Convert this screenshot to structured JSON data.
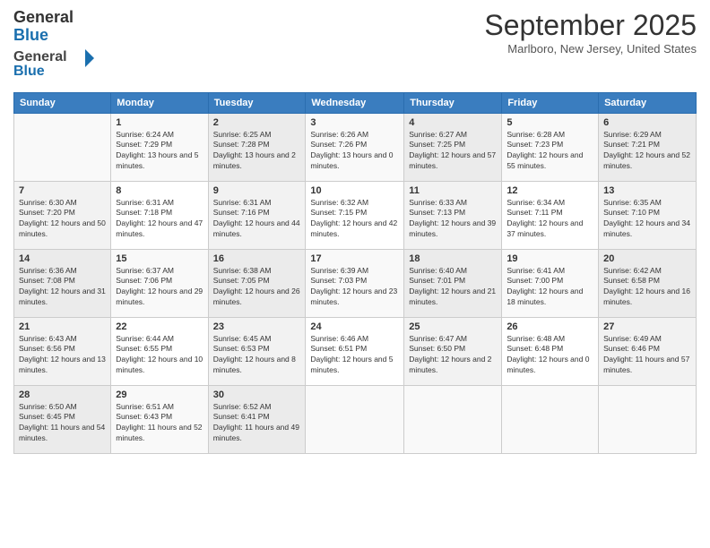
{
  "header": {
    "logo_general": "General",
    "logo_blue": "Blue",
    "month_title": "September 2025",
    "location": "Marlboro, New Jersey, United States"
  },
  "days_of_week": [
    "Sunday",
    "Monday",
    "Tuesday",
    "Wednesday",
    "Thursday",
    "Friday",
    "Saturday"
  ],
  "weeks": [
    [
      {
        "day": "",
        "sunrise": "",
        "sunset": "",
        "daylight": ""
      },
      {
        "day": "1",
        "sunrise": "Sunrise: 6:24 AM",
        "sunset": "Sunset: 7:29 PM",
        "daylight": "Daylight: 13 hours and 5 minutes."
      },
      {
        "day": "2",
        "sunrise": "Sunrise: 6:25 AM",
        "sunset": "Sunset: 7:28 PM",
        "daylight": "Daylight: 13 hours and 2 minutes."
      },
      {
        "day": "3",
        "sunrise": "Sunrise: 6:26 AM",
        "sunset": "Sunset: 7:26 PM",
        "daylight": "Daylight: 13 hours and 0 minutes."
      },
      {
        "day": "4",
        "sunrise": "Sunrise: 6:27 AM",
        "sunset": "Sunset: 7:25 PM",
        "daylight": "Daylight: 12 hours and 57 minutes."
      },
      {
        "day": "5",
        "sunrise": "Sunrise: 6:28 AM",
        "sunset": "Sunset: 7:23 PM",
        "daylight": "Daylight: 12 hours and 55 minutes."
      },
      {
        "day": "6",
        "sunrise": "Sunrise: 6:29 AM",
        "sunset": "Sunset: 7:21 PM",
        "daylight": "Daylight: 12 hours and 52 minutes."
      }
    ],
    [
      {
        "day": "7",
        "sunrise": "Sunrise: 6:30 AM",
        "sunset": "Sunset: 7:20 PM",
        "daylight": "Daylight: 12 hours and 50 minutes."
      },
      {
        "day": "8",
        "sunrise": "Sunrise: 6:31 AM",
        "sunset": "Sunset: 7:18 PM",
        "daylight": "Daylight: 12 hours and 47 minutes."
      },
      {
        "day": "9",
        "sunrise": "Sunrise: 6:31 AM",
        "sunset": "Sunset: 7:16 PM",
        "daylight": "Daylight: 12 hours and 44 minutes."
      },
      {
        "day": "10",
        "sunrise": "Sunrise: 6:32 AM",
        "sunset": "Sunset: 7:15 PM",
        "daylight": "Daylight: 12 hours and 42 minutes."
      },
      {
        "day": "11",
        "sunrise": "Sunrise: 6:33 AM",
        "sunset": "Sunset: 7:13 PM",
        "daylight": "Daylight: 12 hours and 39 minutes."
      },
      {
        "day": "12",
        "sunrise": "Sunrise: 6:34 AM",
        "sunset": "Sunset: 7:11 PM",
        "daylight": "Daylight: 12 hours and 37 minutes."
      },
      {
        "day": "13",
        "sunrise": "Sunrise: 6:35 AM",
        "sunset": "Sunset: 7:10 PM",
        "daylight": "Daylight: 12 hours and 34 minutes."
      }
    ],
    [
      {
        "day": "14",
        "sunrise": "Sunrise: 6:36 AM",
        "sunset": "Sunset: 7:08 PM",
        "daylight": "Daylight: 12 hours and 31 minutes."
      },
      {
        "day": "15",
        "sunrise": "Sunrise: 6:37 AM",
        "sunset": "Sunset: 7:06 PM",
        "daylight": "Daylight: 12 hours and 29 minutes."
      },
      {
        "day": "16",
        "sunrise": "Sunrise: 6:38 AM",
        "sunset": "Sunset: 7:05 PM",
        "daylight": "Daylight: 12 hours and 26 minutes."
      },
      {
        "day": "17",
        "sunrise": "Sunrise: 6:39 AM",
        "sunset": "Sunset: 7:03 PM",
        "daylight": "Daylight: 12 hours and 23 minutes."
      },
      {
        "day": "18",
        "sunrise": "Sunrise: 6:40 AM",
        "sunset": "Sunset: 7:01 PM",
        "daylight": "Daylight: 12 hours and 21 minutes."
      },
      {
        "day": "19",
        "sunrise": "Sunrise: 6:41 AM",
        "sunset": "Sunset: 7:00 PM",
        "daylight": "Daylight: 12 hours and 18 minutes."
      },
      {
        "day": "20",
        "sunrise": "Sunrise: 6:42 AM",
        "sunset": "Sunset: 6:58 PM",
        "daylight": "Daylight: 12 hours and 16 minutes."
      }
    ],
    [
      {
        "day": "21",
        "sunrise": "Sunrise: 6:43 AM",
        "sunset": "Sunset: 6:56 PM",
        "daylight": "Daylight: 12 hours and 13 minutes."
      },
      {
        "day": "22",
        "sunrise": "Sunrise: 6:44 AM",
        "sunset": "Sunset: 6:55 PM",
        "daylight": "Daylight: 12 hours and 10 minutes."
      },
      {
        "day": "23",
        "sunrise": "Sunrise: 6:45 AM",
        "sunset": "Sunset: 6:53 PM",
        "daylight": "Daylight: 12 hours and 8 minutes."
      },
      {
        "day": "24",
        "sunrise": "Sunrise: 6:46 AM",
        "sunset": "Sunset: 6:51 PM",
        "daylight": "Daylight: 12 hours and 5 minutes."
      },
      {
        "day": "25",
        "sunrise": "Sunrise: 6:47 AM",
        "sunset": "Sunset: 6:50 PM",
        "daylight": "Daylight: 12 hours and 2 minutes."
      },
      {
        "day": "26",
        "sunrise": "Sunrise: 6:48 AM",
        "sunset": "Sunset: 6:48 PM",
        "daylight": "Daylight: 12 hours and 0 minutes."
      },
      {
        "day": "27",
        "sunrise": "Sunrise: 6:49 AM",
        "sunset": "Sunset: 6:46 PM",
        "daylight": "Daylight: 11 hours and 57 minutes."
      }
    ],
    [
      {
        "day": "28",
        "sunrise": "Sunrise: 6:50 AM",
        "sunset": "Sunset: 6:45 PM",
        "daylight": "Daylight: 11 hours and 54 minutes."
      },
      {
        "day": "29",
        "sunrise": "Sunrise: 6:51 AM",
        "sunset": "Sunset: 6:43 PM",
        "daylight": "Daylight: 11 hours and 52 minutes."
      },
      {
        "day": "30",
        "sunrise": "Sunrise: 6:52 AM",
        "sunset": "Sunset: 6:41 PM",
        "daylight": "Daylight: 11 hours and 49 minutes."
      },
      {
        "day": "",
        "sunrise": "",
        "sunset": "",
        "daylight": ""
      },
      {
        "day": "",
        "sunrise": "",
        "sunset": "",
        "daylight": ""
      },
      {
        "day": "",
        "sunrise": "",
        "sunset": "",
        "daylight": ""
      },
      {
        "day": "",
        "sunrise": "",
        "sunset": "",
        "daylight": ""
      }
    ]
  ]
}
